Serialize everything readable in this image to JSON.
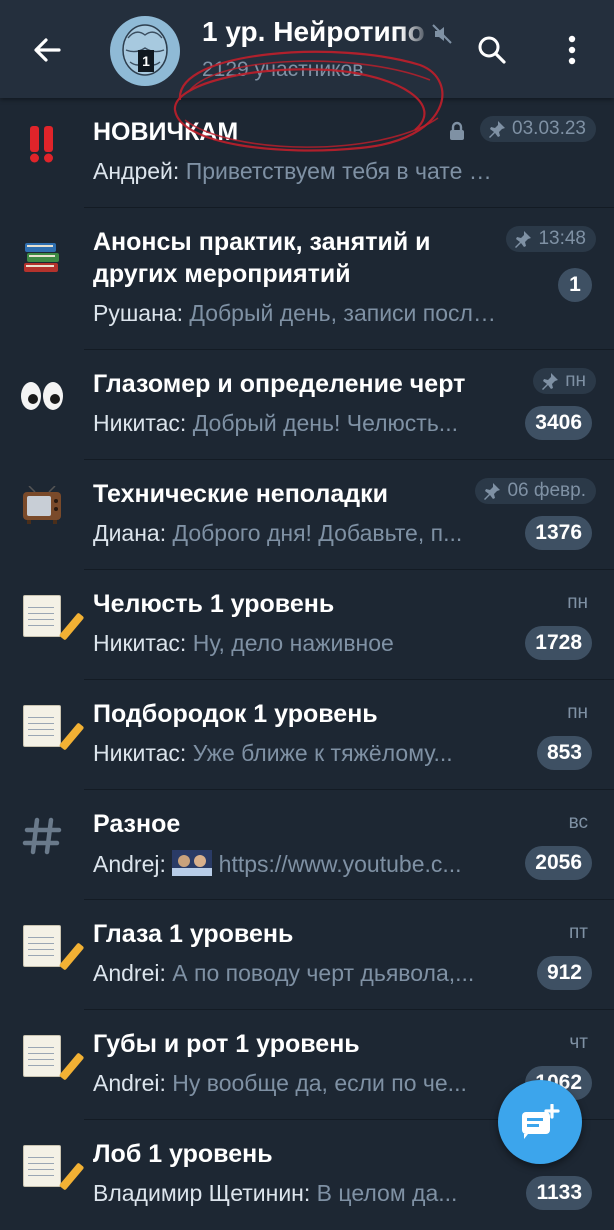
{
  "header": {
    "title": "1 ур. Нейротипо",
    "subtitle": "2129 участников",
    "avatar_number": "1"
  },
  "chats": [
    {
      "icon": "double-exclamation-icon",
      "title": "НОВИЧКАМ",
      "sender": "Андрей:",
      "message": "Приветствуем тебя в чате обуч...",
      "time": "03.03.23",
      "pinned": true,
      "locked": true,
      "badge": ""
    },
    {
      "icon": "books-icon",
      "title": "Анонсы практик, занятий и других мероприятий",
      "sender": "Рушана:",
      "message": "Добрый день, записи после...",
      "time": "13:48",
      "pinned": true,
      "badge": "1"
    },
    {
      "icon": "eyes-icon",
      "title": "Глазомер и определение черт",
      "sender": "Никитас:",
      "message": "Добрый день!  Челюсть...",
      "time": "пн",
      "pinned": true,
      "badge": "3406"
    },
    {
      "icon": "tv-icon",
      "title": "Технические неполадки",
      "sender": "Диана:",
      "message": "Доброго дня! Добавьте, п...",
      "time": "06 февр.",
      "pinned": true,
      "badge": "1376"
    },
    {
      "icon": "notebook-pencil-icon",
      "title": "Челюсть 1 уровень",
      "sender": "Никитас:",
      "message": "Ну, дело наживное",
      "time": "пн",
      "badge": "1728"
    },
    {
      "icon": "notebook-pencil-icon",
      "title": "Подбородок 1 уровень",
      "sender": "Никитас:",
      "message": "Уже ближе к тяжёлому...",
      "time": "пн",
      "badge": "853"
    },
    {
      "icon": "hash-icon",
      "title": "Разное",
      "sender": "Andrej:",
      "message": "https://www.youtube.c...",
      "time": "вс",
      "badge": "2056"
    },
    {
      "icon": "notebook-pencil-icon",
      "title": "Глаза 1 уровень",
      "sender": "Andrei:",
      "message": "А по поводу черт дьявола,...",
      "time": "пт",
      "badge": "912"
    },
    {
      "icon": "notebook-pencil-icon",
      "title": "Губы и рот 1 уровень",
      "sender": "Andrei:",
      "message": "Ну вообще да, если по че...",
      "time": "чт",
      "badge": "1062"
    },
    {
      "icon": "notebook-pencil-icon",
      "title": "Лоб 1 уровень",
      "sender": "Владимир Щетинин:",
      "message": "В целом да...",
      "time": "",
      "badge": "1133"
    }
  ],
  "colors": {
    "background": "#1d2733",
    "header": "#242f3d",
    "accent": "#3ca5ec",
    "muted_text": "#7f91a4",
    "badge": "#3e5063"
  }
}
